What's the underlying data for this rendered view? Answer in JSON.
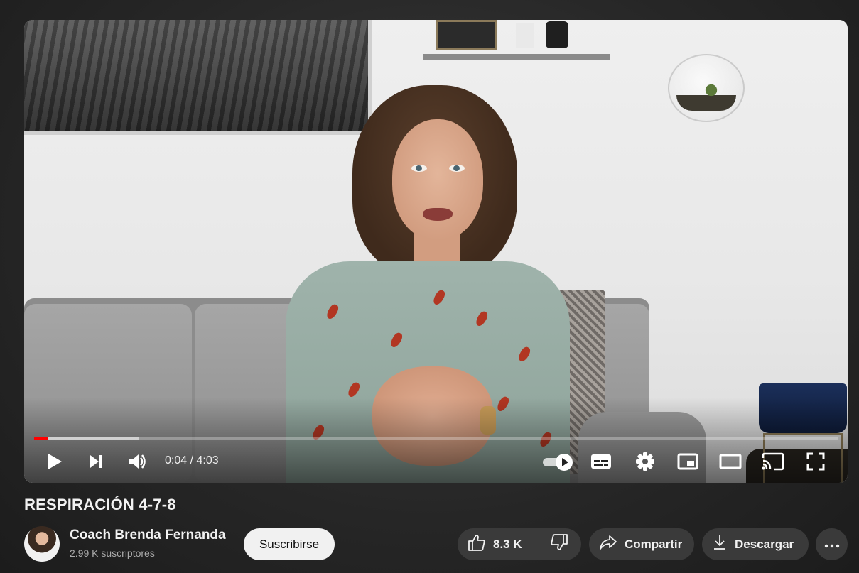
{
  "player": {
    "current_time": "0:04",
    "duration": "4:03",
    "time_display": "0:04 / 4:03",
    "played_fraction": 0.017,
    "buffered_fraction": 0.13,
    "autoplay_on": true,
    "progress_color": "#ff0000",
    "controls": {
      "left": [
        "play-icon",
        "next-icon",
        "volume-icon"
      ],
      "right": [
        "autoplay-toggle",
        "subtitles-icon",
        "settings-gear-icon",
        "miniplayer-icon",
        "theater-mode-icon",
        "cast-icon",
        "fullscreen-icon"
      ]
    }
  },
  "video": {
    "title": "RESPIRACIÓN 4-7-8"
  },
  "channel": {
    "name": "Coach Brenda Fernanda",
    "subscribers": "2.99 K suscriptores",
    "subscribe_label": "Suscribirse"
  },
  "actions": {
    "likes": "8.3 K",
    "share_label": "Compartir",
    "download_label": "Descargar",
    "like_icon": "thumbs-up-icon",
    "dislike_icon": "thumbs-down-icon",
    "share_icon": "share-arrow-icon",
    "download_icon": "download-icon",
    "more_icon": "more-horizontal-icon"
  },
  "colors": {
    "page_background": "#272727",
    "pill_background": "#3a3a3a",
    "subscribe_background": "#f1f1f1"
  }
}
